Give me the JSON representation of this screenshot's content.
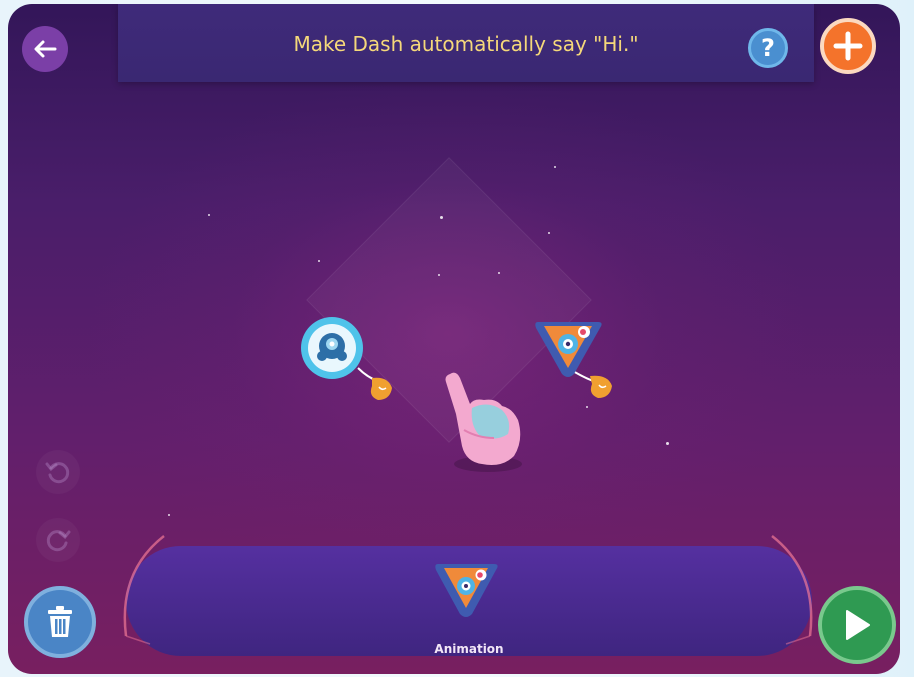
{
  "header": {
    "title": "Make Dash automatically say \"Hi.\"",
    "back_icon": "arrow-left-icon",
    "help_label": "?",
    "add_icon": "plus-icon"
  },
  "canvas": {
    "blocks": [
      {
        "name": "start-block",
        "icon": "dash-robot-icon"
      },
      {
        "name": "animation-block",
        "icon": "animation-icon"
      }
    ],
    "hint_icon": "pointing-hand-icon"
  },
  "palette": {
    "items": [
      {
        "label": "Animation",
        "icon": "animation-icon"
      }
    ]
  },
  "controls": {
    "undo_icon": "undo-icon",
    "redo_icon": "redo-icon",
    "trash_icon": "trash-icon",
    "play_icon": "play-icon"
  },
  "colors": {
    "title_text": "#f5d87a",
    "add_button": "#f4732b",
    "play_button": "#2f9a52",
    "trash_button": "#4a85c6"
  }
}
